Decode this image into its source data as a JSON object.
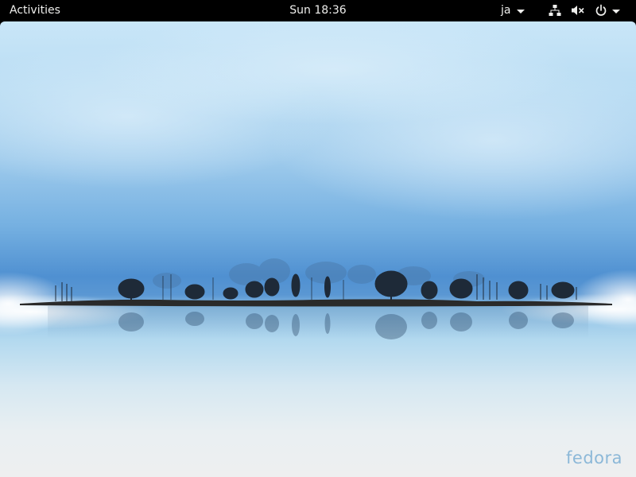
{
  "topbar": {
    "activities_label": "Activities",
    "clock": "Sun 18:36",
    "input_source": "ja",
    "status_icons": [
      "network-wired-icon",
      "volume-muted-icon",
      "power-icon"
    ]
  },
  "desktop": {
    "brand_watermark": "fedora"
  },
  "colors": {
    "topbar_bg": "#000000",
    "topbar_text": "#eeeeec",
    "sky_top": "#c9e6f8",
    "sky_mid": "#4f90d1",
    "water_bottom": "#eeeff0",
    "brand": "#8cb8d8"
  }
}
